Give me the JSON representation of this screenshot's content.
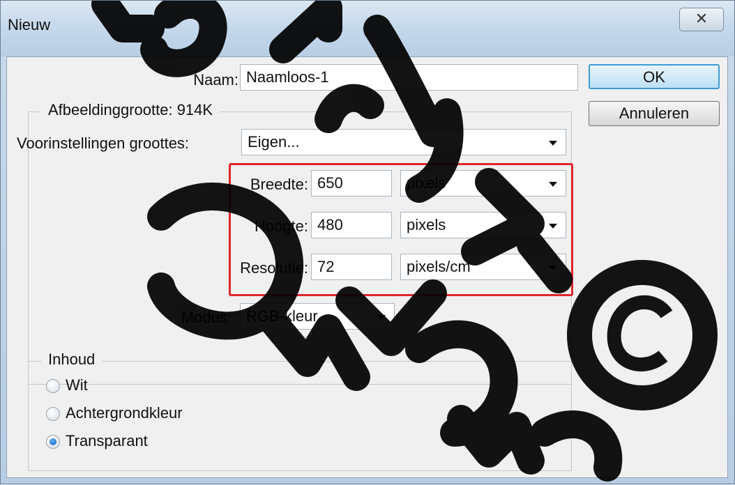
{
  "window": {
    "title": "Nieuw",
    "close_glyph": "✕"
  },
  "naam": {
    "label": "Naam:",
    "value": "Naamloos-1"
  },
  "buttons": {
    "ok": "OK",
    "cancel": "Annuleren"
  },
  "image_size": {
    "group_title": "Afbeeldinggrootte: 914K",
    "preset_label": "Voorinstellingen groottes:",
    "preset_value": "Eigen...",
    "width_label": "Breedte:",
    "width_value": "650",
    "width_unit": "pixels",
    "height_label": "Hoogte:",
    "height_value": "480",
    "height_unit": "pixels",
    "resolution_label": "Resolutie:",
    "resolution_value": "72",
    "resolution_unit": "pixels/cm",
    "mode_label": "Modus:",
    "mode_value": "RGB-kleur"
  },
  "content": {
    "group_title": "Inhoud",
    "options": [
      {
        "label": "Wit",
        "selected": false
      },
      {
        "label": "Achtergrondkleur",
        "selected": false
      },
      {
        "label": "Transparant",
        "selected": true
      }
    ]
  },
  "colors": {
    "highlight": "#e0262b",
    "default_button": "#3c9bd6"
  }
}
